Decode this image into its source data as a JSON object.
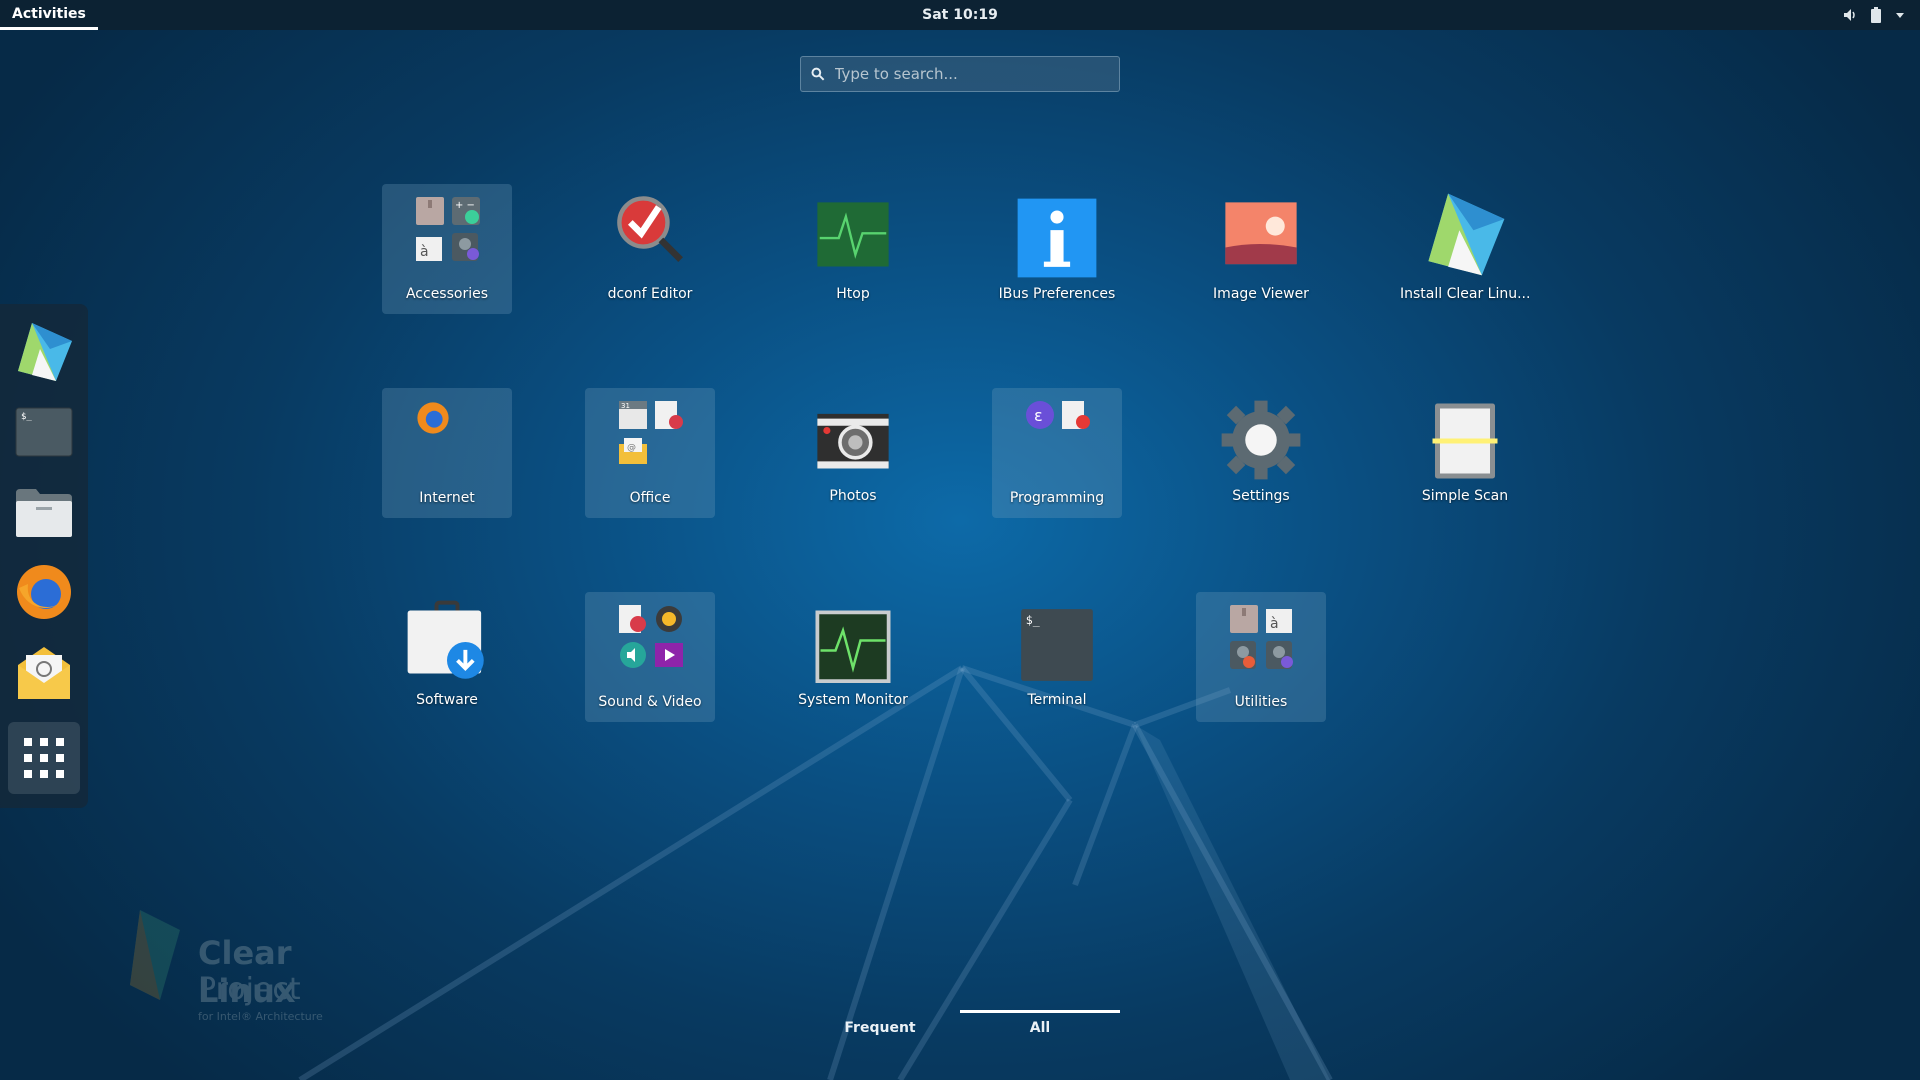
{
  "topbar": {
    "activities_label": "Activities",
    "clock": "Sat 10:19",
    "tray_icons": [
      "volume-icon",
      "battery-icon",
      "dropdown-arrow-icon"
    ]
  },
  "search": {
    "placeholder": "Type to search..."
  },
  "dash": {
    "items": [
      {
        "name": "clear-linux-installer",
        "icon": "clear-linux-icon"
      },
      {
        "name": "terminal",
        "icon": "terminal-icon"
      },
      {
        "name": "files",
        "icon": "folder-icon"
      },
      {
        "name": "firefox",
        "icon": "firefox-icon"
      },
      {
        "name": "mail",
        "icon": "mail-icon"
      },
      {
        "name": "show-applications",
        "icon": "app-grid-icon"
      }
    ]
  },
  "apps": [
    {
      "label": "Accessories",
      "type": "folder"
    },
    {
      "label": "dconf Editor",
      "type": "app"
    },
    {
      "label": "Htop",
      "type": "app"
    },
    {
      "label": "IBus Preferences",
      "type": "app"
    },
    {
      "label": "Image Viewer",
      "type": "app"
    },
    {
      "label": "Install Clear Linu...",
      "type": "app"
    },
    {
      "label": "Internet",
      "type": "folder"
    },
    {
      "label": "Office",
      "type": "folder"
    },
    {
      "label": "Photos",
      "type": "app"
    },
    {
      "label": "Programming",
      "type": "folder"
    },
    {
      "label": "Settings",
      "type": "app"
    },
    {
      "label": "Simple Scan",
      "type": "app"
    },
    {
      "label": "Software",
      "type": "app"
    },
    {
      "label": "Sound & Video",
      "type": "folder"
    },
    {
      "label": "System Monitor",
      "type": "app"
    },
    {
      "label": "Terminal",
      "type": "app"
    },
    {
      "label": "Utilities",
      "type": "folder"
    }
  ],
  "view_switcher": {
    "frequent": "Frequent",
    "all": "All",
    "selected": "All"
  },
  "watermark": {
    "line1": "Clear Linux",
    "line2": "Project",
    "line3": "for Intel® Architecture"
  },
  "colors": {
    "topbar": "#0c2233",
    "background": "#0a4f82",
    "accent": "#3ab4f2"
  }
}
